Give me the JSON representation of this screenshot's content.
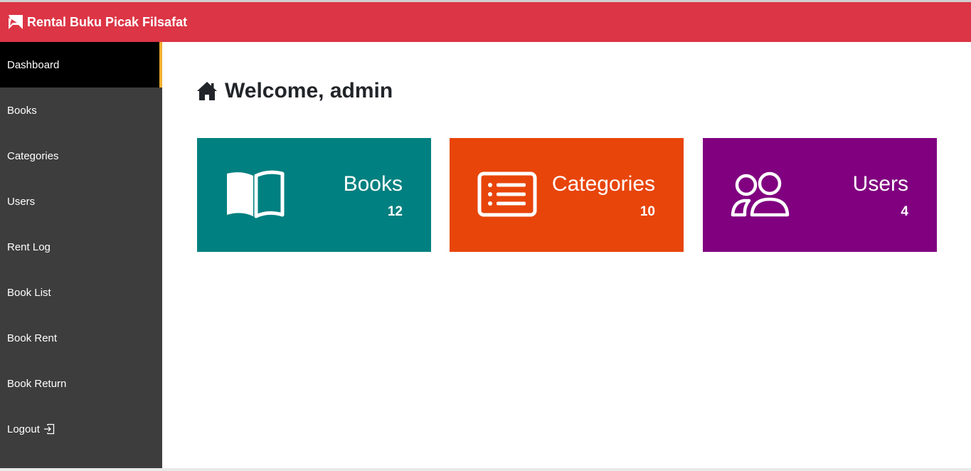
{
  "navbar": {
    "brand": "Rental Buku Picak Filsafat",
    "logo_icon": "book-logo-icon",
    "background": "#dc3545"
  },
  "sidebar": {
    "items": [
      {
        "label": "Dashboard",
        "active": true
      },
      {
        "label": "Books"
      },
      {
        "label": "Categories"
      },
      {
        "label": "Users"
      },
      {
        "label": "Rent Log"
      },
      {
        "label": "Book List"
      },
      {
        "label": "Book Rent"
      },
      {
        "label": "Book Return"
      },
      {
        "label": "Logout",
        "icon": "logout-icon"
      }
    ],
    "background": "#3d3d3d",
    "active_background": "#000000",
    "active_accent": "#f0ad2e"
  },
  "main": {
    "welcome": "Welcome, admin",
    "welcome_icon": "home-icon",
    "cards": [
      {
        "title": "Books",
        "count": "12",
        "icon": "open-book-icon",
        "color": "#008080"
      },
      {
        "title": "Categories",
        "count": "10",
        "icon": "list-card-icon",
        "color": "#e8450a"
      },
      {
        "title": "Users",
        "count": "4",
        "icon": "people-icon",
        "color": "#800080"
      }
    ]
  }
}
